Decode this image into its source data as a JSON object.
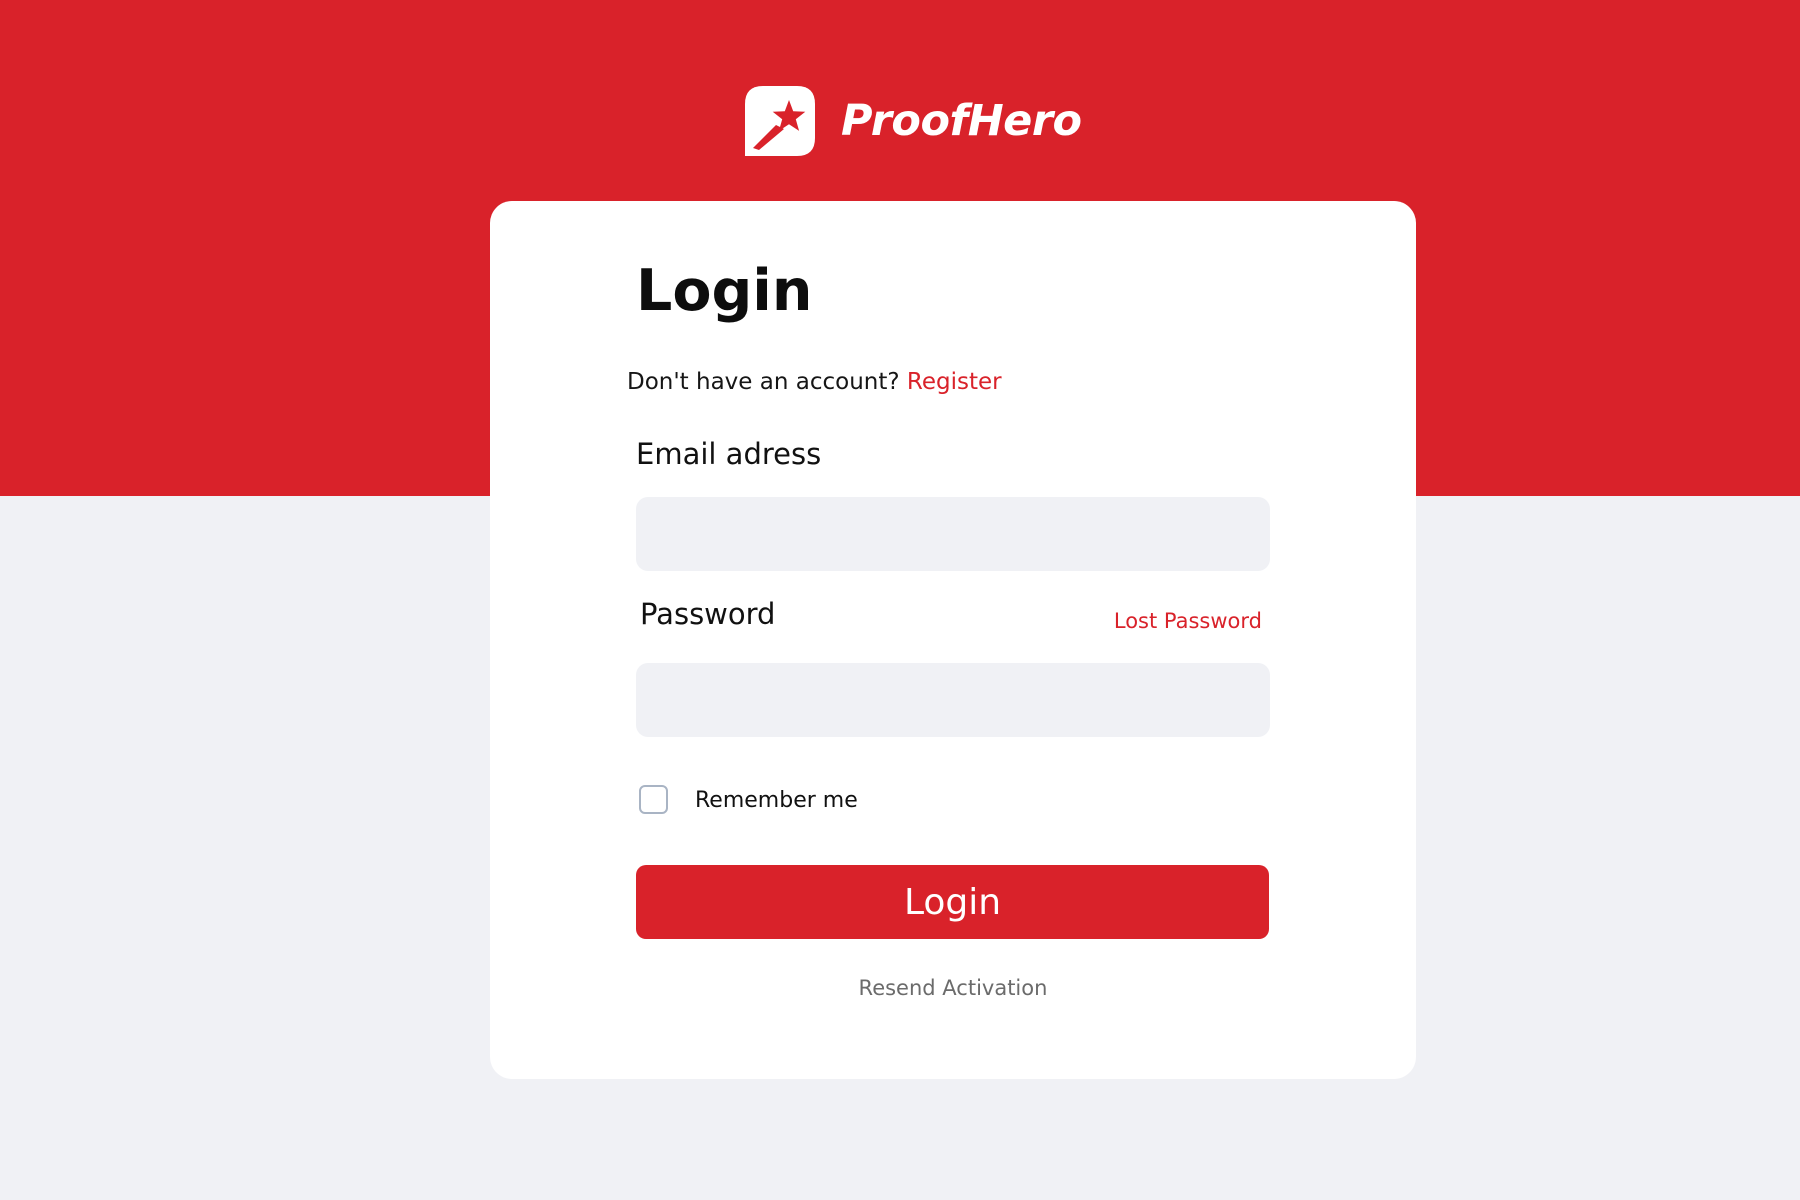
{
  "brand": {
    "name": "ProofHero",
    "logo_icon": "shooting-star-icon",
    "accent_color": "#d9222a"
  },
  "login_form": {
    "title": "Login",
    "no_account_text": "Don't have an account?",
    "register_link": "Register",
    "email_label": "Email adress",
    "email_value": "",
    "password_label": "Password",
    "password_value": "",
    "lost_password_link": "Lost Password",
    "remember_label": "Remember me",
    "remember_checked": false,
    "login_button": "Login",
    "resend_link": "Resend Activation"
  }
}
